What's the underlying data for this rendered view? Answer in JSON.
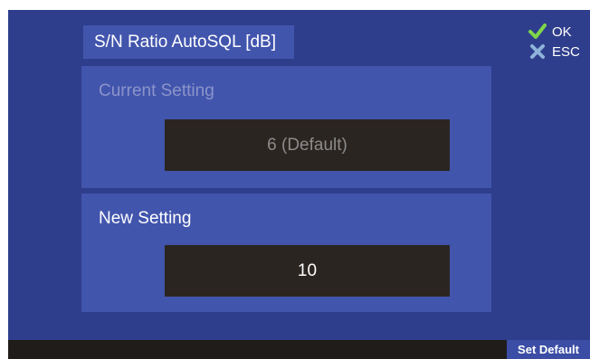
{
  "title": "S/N Ratio AutoSQL [dB]",
  "current": {
    "label": "Current Setting",
    "value": "6 (Default)"
  },
  "new_setting": {
    "label": "New Setting",
    "value": "10"
  },
  "actions": {
    "ok_label": "OK",
    "esc_label": "ESC"
  },
  "footer": {
    "set_default_label": "Set Default"
  },
  "colors": {
    "background": "#2f3e8c",
    "panel": "#4255ad",
    "value_box": "#2b2521",
    "ok_icon": "#7fd64a",
    "esc_icon": "#8fb3d9"
  },
  "icons": {
    "ok": "checkmark-icon",
    "esc": "x-icon"
  }
}
